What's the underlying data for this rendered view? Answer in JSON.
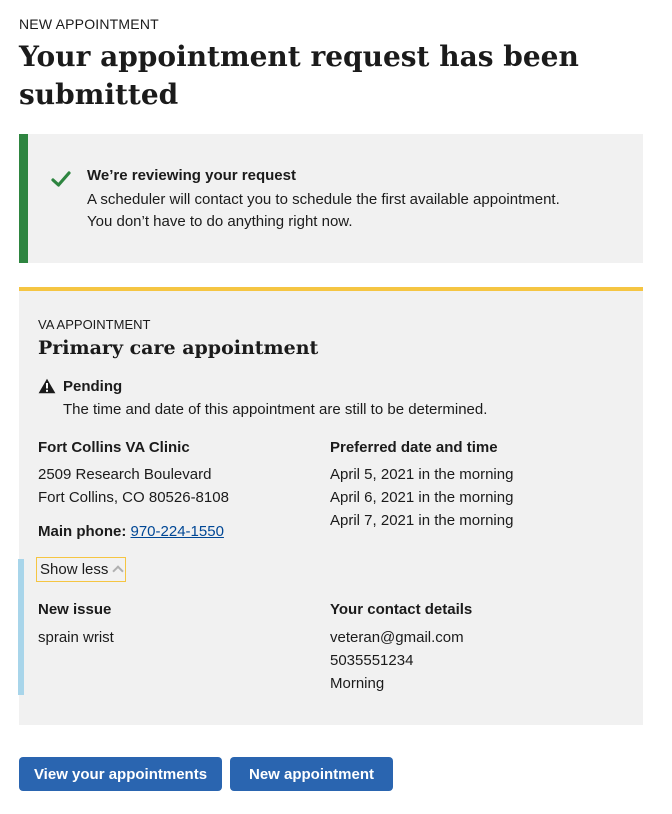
{
  "header": {
    "eyebrow": "NEW APPOINTMENT",
    "title": "Your appointment request has been submitted"
  },
  "alert": {
    "status": "success",
    "icon": "check-icon",
    "heading": "We’re reviewing your request",
    "body_line1": "A scheduler will contact you to schedule the first available appointment.",
    "body_line2": "You don’t have to do anything right now."
  },
  "appointment": {
    "eyebrow": "VA APPOINTMENT",
    "title": "Primary care appointment",
    "status_icon": "warning-icon",
    "status_label": "Pending",
    "status_desc": "The time and date of this appointment are still to be determined.",
    "clinic": {
      "name": "Fort Collins VA Clinic",
      "address_line1": "2509 Research Boulevard",
      "address_line2": "Fort Collins, CO 80526-8108",
      "phone_label": "Main phone:",
      "phone": "970-224-1550"
    },
    "preferred": {
      "heading": "Preferred date and time",
      "dates": [
        "April 5, 2021 in the morning",
        "April 6, 2021 in the morning",
        "April 7, 2021 in the morning"
      ]
    },
    "toggle_label": "Show less",
    "issue": {
      "heading": "New issue",
      "text": "sprain wrist"
    },
    "contact": {
      "heading": "Your contact details",
      "email": "veteran@gmail.com",
      "phone": "5035551234",
      "best_time": "Morning"
    }
  },
  "actions": {
    "view_label": "View your appointments",
    "new_label": "New appointment"
  },
  "colors": {
    "success": "#2e8540",
    "accent": "#f5c542",
    "primary": "#2a65b0",
    "link": "#004795",
    "panel": "#f1f1f1",
    "expand_bar": "#a8d5ea"
  }
}
